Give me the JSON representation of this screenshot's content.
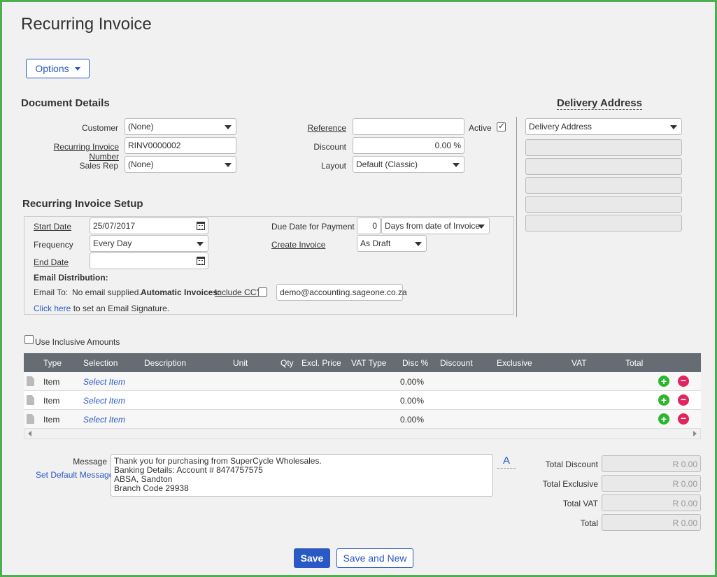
{
  "page": {
    "title": "Recurring Invoice"
  },
  "options_button": {
    "label": "Options"
  },
  "document_details": {
    "title": "Document Details",
    "customer": {
      "label": "Customer",
      "value": "(None)"
    },
    "invoice_number": {
      "label": "Recurring Invoice Number",
      "value": "RINV0000002"
    },
    "sales_rep": {
      "label": "Sales Rep",
      "value": "(None)"
    },
    "reference": {
      "label": "Reference",
      "value": ""
    },
    "active": {
      "label": "Active",
      "checked": true
    },
    "discount": {
      "label": "Discount",
      "value": "0.00 %"
    },
    "layout": {
      "label": "Layout",
      "value": "Default (Classic)"
    }
  },
  "delivery_address": {
    "title": "Delivery Address",
    "select_value": "Delivery Address",
    "lines": [
      "",
      "",
      "",
      "",
      ""
    ]
  },
  "setup": {
    "title": "Recurring Invoice Setup",
    "start_date": {
      "label": "Start Date",
      "value": "25/07/2017"
    },
    "frequency": {
      "label": "Frequency",
      "value": "Every Day"
    },
    "end_date": {
      "label": "End Date",
      "value": ""
    },
    "due_date": {
      "label": "Due Date for Payment",
      "days": "0",
      "option": "Days from date of Invoice"
    },
    "create_invoice": {
      "label": "Create Invoice",
      "value": "As Draft"
    },
    "email_distribution_label": "Email Distribution:",
    "email_to_label": "Email To:",
    "email_to_value": "No email supplied.",
    "automatic_invoices_label": "Automatic Invoices:",
    "include_cc_label": "Include CC?",
    "cc_email": "demo@accounting.sageone.co.za",
    "click_here": "Click here",
    "signature_text": "to set an Email Signature."
  },
  "inclusive_amounts_label": "Use Inclusive Amounts",
  "table": {
    "columns": [
      "Type",
      "Selection",
      "Description",
      "Unit",
      "Qty",
      "Excl. Price",
      "VAT Type",
      "Disc %",
      "Discount",
      "Exclusive",
      "VAT",
      "Total"
    ],
    "rows": [
      {
        "type": "Item",
        "selection": "Select Item",
        "disc": "0.00%"
      },
      {
        "type": "Item",
        "selection": "Select Item",
        "disc": "0.00%"
      },
      {
        "type": "Item",
        "selection": "Select Item",
        "disc": "0.00%"
      }
    ]
  },
  "message": {
    "label": "Message",
    "set_default": "Set Default Message",
    "text": "Thank you for purchasing from SuperCycle Wholesales.\nBanking Details:  Account # 8474757575\nABSA, Sandton\nBranch Code 29938",
    "format_button": "A"
  },
  "totals": {
    "total_discount": {
      "label": "Total Discount",
      "value": "R 0.00"
    },
    "total_exclusive": {
      "label": "Total Exclusive",
      "value": "R 0.00"
    },
    "total_vat": {
      "label": "Total VAT",
      "value": "R 0.00"
    },
    "total": {
      "label": "Total",
      "value": "R 0.00"
    }
  },
  "buttons": {
    "save": "Save",
    "save_and_new": "Save and New"
  },
  "colors": {
    "accent": "#2b59c3",
    "frame": "#4caf50",
    "table_header": "#666c73",
    "add": "#2db52d",
    "remove": "#e0245e"
  }
}
